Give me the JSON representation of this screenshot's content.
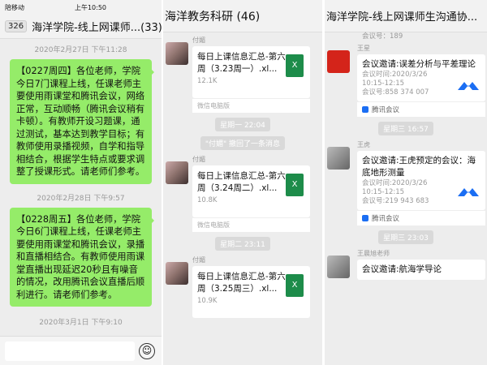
{
  "panel1": {
    "status": {
      "carrier": "陪移动",
      "time": "上午10:50"
    },
    "header": {
      "badge": "326",
      "title": "海洋学院-线上网课师...(33)"
    },
    "messages": [
      {
        "ts": "2020年2月27日 下午11:28",
        "text": "【0227周四】各位老师，学院今日7门课程上线，任课老师主要使用雨课堂和腾讯会议，网络正常，互动顺畅（腾讯会议稍有卡顿）。有教师开设习题课，通过测试，基本达到教学目标；有教师使用录播视频，自学和指导相结合，根据学生特点或要求调整了授课形式。请老师们参考。"
      },
      {
        "ts": "2020年2月28日 下午9:57",
        "text": "【0228周五】各位老师，学院今日6门课程上线，任课老师主要使用雨课堂和腾讯会议，录播和直播相结合。有教师使用雨课堂直播出现延迟20秒且有噪音的情况，改用腾讯会议直播后顺利进行。请老师们参考。"
      }
    ],
    "last_ts": "2020年3月1日 下午9:10",
    "emoji_icon": "☺"
  },
  "panel2": {
    "header": {
      "title": "海洋教务科研 (46)"
    },
    "items": [
      {
        "sender": "付媚",
        "file_title": "每日上课信息汇总-第六周（3.23周一）.xl...",
        "size": "12.1K",
        "source": "微信电脑版"
      },
      {
        "pill": "星期一 22:04"
      },
      {
        "pill": "\"付媚\" 撤回了一条消息"
      },
      {
        "sender": "付媚",
        "file_title": "每日上课信息汇总-第六周（3.24周二）.xl...",
        "size": "10.8K",
        "source": "微信电脑版"
      },
      {
        "pill": "星期二 23:11"
      },
      {
        "sender": "付媚",
        "file_title": "每日上课信息汇总-第六周（3.25周三）.xl...",
        "size": "10.9K",
        "source": ""
      }
    ]
  },
  "panel3": {
    "header": {
      "title": "海洋学院-线上网课师生沟通协..."
    },
    "top_fragment": "会议号：189",
    "items": [
      {
        "sender": "王星",
        "title": "会议邀请:误差分析与平差理论",
        "time": "会议时间:2020/3/26",
        "range": "10:15-12:15",
        "room": "会议号:858 374 007",
        "footer": "腾讯会议"
      },
      {
        "pill": "星期三 16:57"
      },
      {
        "sender": "王虎",
        "title": "会议邀请:王虎预定的会议：海底地形测量",
        "time": "会议时间:2020/3/26",
        "range": "10:15-12:15",
        "room": "会议号:219 943 683",
        "footer": "腾讯会议"
      },
      {
        "pill": "星期三 23:03"
      },
      {
        "sender": "王晨旭老师",
        "title": "会议邀请:航海学导论"
      }
    ]
  },
  "colors": {
    "green_bubble": "#95ec69",
    "excel": "#1d8c4a",
    "tencent": "#1b6ef3"
  }
}
